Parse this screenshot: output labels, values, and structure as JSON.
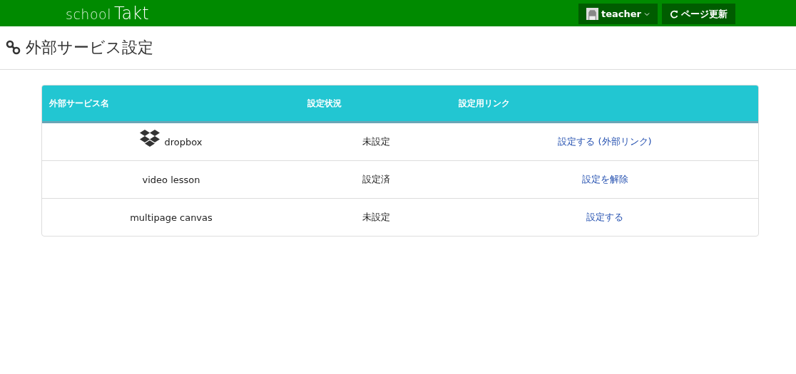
{
  "header": {
    "logo": {
      "part_1": "school",
      "part_2": "Takt"
    },
    "user_button": "teacher",
    "reload_button": "ページ更新"
  },
  "page_title": "外部サービス設定",
  "table": {
    "columns": [
      "外部サービス名",
      "設定状況",
      "設定用リンク"
    ],
    "rows": [
      {
        "kind": "with_icon",
        "name": "dropbox",
        "status": "未設定",
        "link": "設定する (外部リンク)"
      },
      {
        "kind": "plain",
        "name": "video lesson",
        "status": "設定済",
        "link": "設定を解除"
      },
      {
        "kind": "plain",
        "name": "multipage canvas",
        "status": "未設定",
        "link": "設定する"
      }
    ]
  }
}
